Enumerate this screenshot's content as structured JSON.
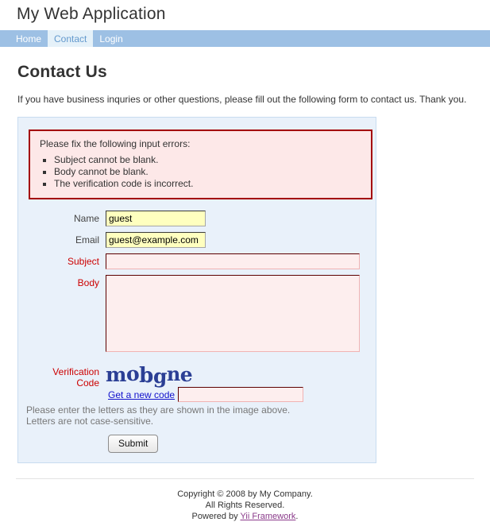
{
  "header": {
    "logo": "My Web Application"
  },
  "nav": {
    "items": [
      {
        "label": "Home",
        "active": false
      },
      {
        "label": "Contact",
        "active": true
      },
      {
        "label": "Login",
        "active": false
      }
    ]
  },
  "main": {
    "page_title": "Contact Us",
    "intro": "If you have business inquries or other questions, please fill out the following form to contact us. Thank you."
  },
  "error_summary": {
    "heading": "Please fix the following input errors:",
    "errors": [
      "Subject cannot be blank.",
      "Body cannot be blank.",
      "The verification code is incorrect."
    ]
  },
  "form": {
    "fields": [
      {
        "label": "Name",
        "value": "guest",
        "placeholder": "",
        "state": "filled"
      },
      {
        "label": "Email",
        "value": "guest@example.com",
        "placeholder": "",
        "state": "filled"
      },
      {
        "label": "Subject",
        "value": "",
        "placeholder": "",
        "state": "error"
      },
      {
        "label": "Body",
        "value": "",
        "placeholder": "",
        "state": "error"
      }
    ],
    "captcha": {
      "label_line1": "Verification",
      "label_line2": "Code",
      "code_text": "mobgne",
      "refresh_link": "Get a new code",
      "input_value": "",
      "hint_line1": "Please enter the letters as they are shown in the image above.",
      "hint_line2": "Letters are not case-sensitive."
    },
    "submit_label": "Submit"
  },
  "footer": {
    "line1": "Copyright © 2008 by My Company.",
    "line2": "All Rights Reserved.",
    "powered_prefix": "Powered by ",
    "powered_link": "Yii Framework",
    "powered_suffix": "."
  },
  "colors": {
    "nav_bg": "#9dc0e4",
    "nav_active_bg": "#e5f1f9",
    "nav_active_text": "#6399cd",
    "form_bg": "#e9f1fa",
    "error_border": "#a40000",
    "error_bg": "#fde8e8",
    "error_label": "#cc0000",
    "autofill_bg": "#ffffbf",
    "captcha_text": "#2b3f95",
    "link": "#1111cc",
    "footer_link": "#8a3a8a"
  }
}
